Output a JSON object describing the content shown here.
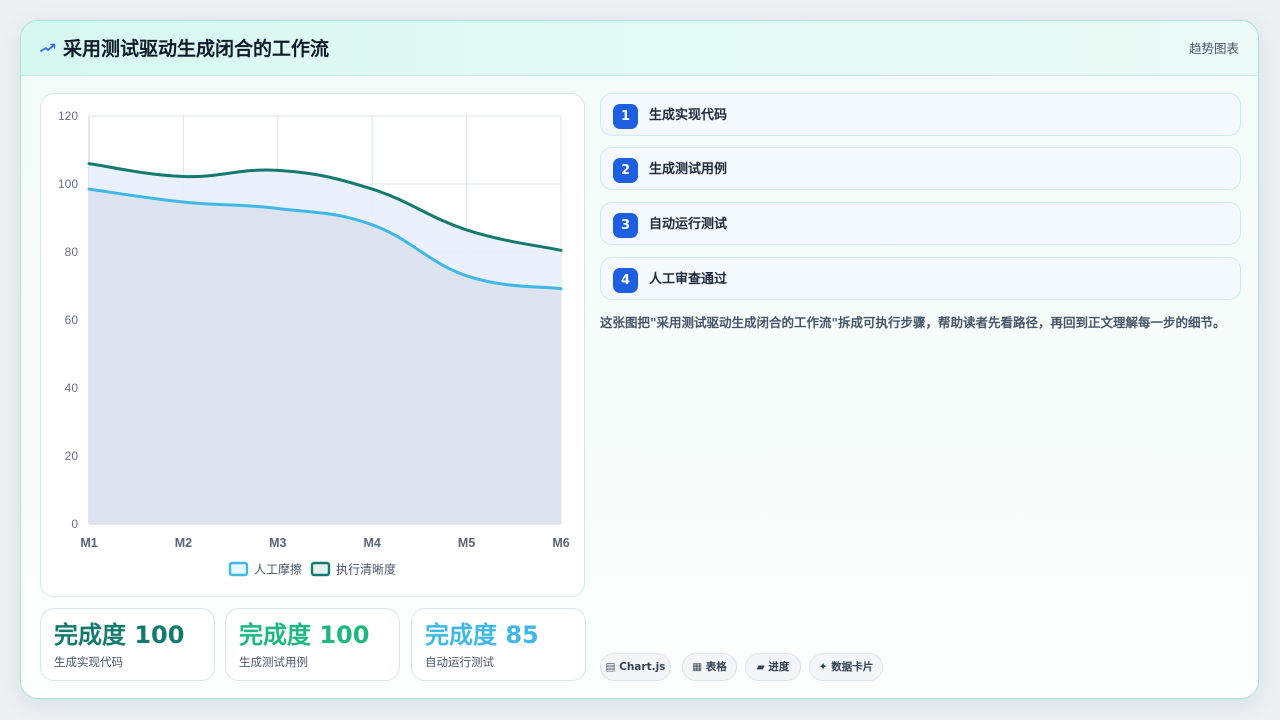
{
  "header": {
    "icon": "trend-spark-icon",
    "title": "采用测试驱动生成闭合的工作流",
    "tag": "趋势图表"
  },
  "colors": {
    "series_a": "#3fb8e8",
    "series_a_fill": "#dce3ef",
    "series_b": "#137a6e",
    "series_b_fill": "#e8effc",
    "step_badge": "#1d5fe0",
    "stat_1": "#137a6e",
    "stat_2": "#1db87e",
    "stat_3": "#3fb8e8"
  },
  "chart_data": {
    "type": "area",
    "categories": [
      "M1",
      "M2",
      "M3",
      "M4",
      "M5",
      "M6"
    ],
    "series": [
      {
        "name": "人工摩擦",
        "values": [
          98.5,
          94.7,
          92.8,
          88.0,
          73.0,
          69.2
        ]
      },
      {
        "name": "执行清晰度",
        "values": [
          106.0,
          102.2,
          104.0,
          98.5,
          86.5,
          80.5
        ]
      }
    ],
    "ylim": [
      0,
      120
    ],
    "yticks": [
      0,
      20,
      40,
      60,
      80,
      100,
      120
    ],
    "grid": true,
    "legend": "bottom"
  },
  "stats": [
    {
      "value": "完成度 100",
      "label": "生成实现代码"
    },
    {
      "value": "完成度 100",
      "label": "生成测试用例"
    },
    {
      "value": "完成度 85",
      "label": "自动运行测试"
    }
  ],
  "steps": [
    {
      "num": "1",
      "label": "生成实现代码"
    },
    {
      "num": "2",
      "label": "生成测试用例"
    },
    {
      "num": "3",
      "label": "自动运行测试"
    },
    {
      "num": "4",
      "label": "人工审查通过"
    }
  ],
  "description": "这张图把\"采用测试驱动生成闭合的工作流\"拆成可执行步骤，帮助读者先看路径，再回到正文理解每一步的细节。",
  "chips": [
    {
      "icon": "chart-icon",
      "glyph": "▤",
      "label": "Chart.js"
    },
    {
      "icon": "table-icon",
      "glyph": "▦",
      "label": "表格"
    },
    {
      "icon": "progress-icon",
      "glyph": "▰",
      "label": "进度"
    },
    {
      "icon": "sparkle-icon",
      "glyph": "✦",
      "label": "数据卡片"
    }
  ]
}
